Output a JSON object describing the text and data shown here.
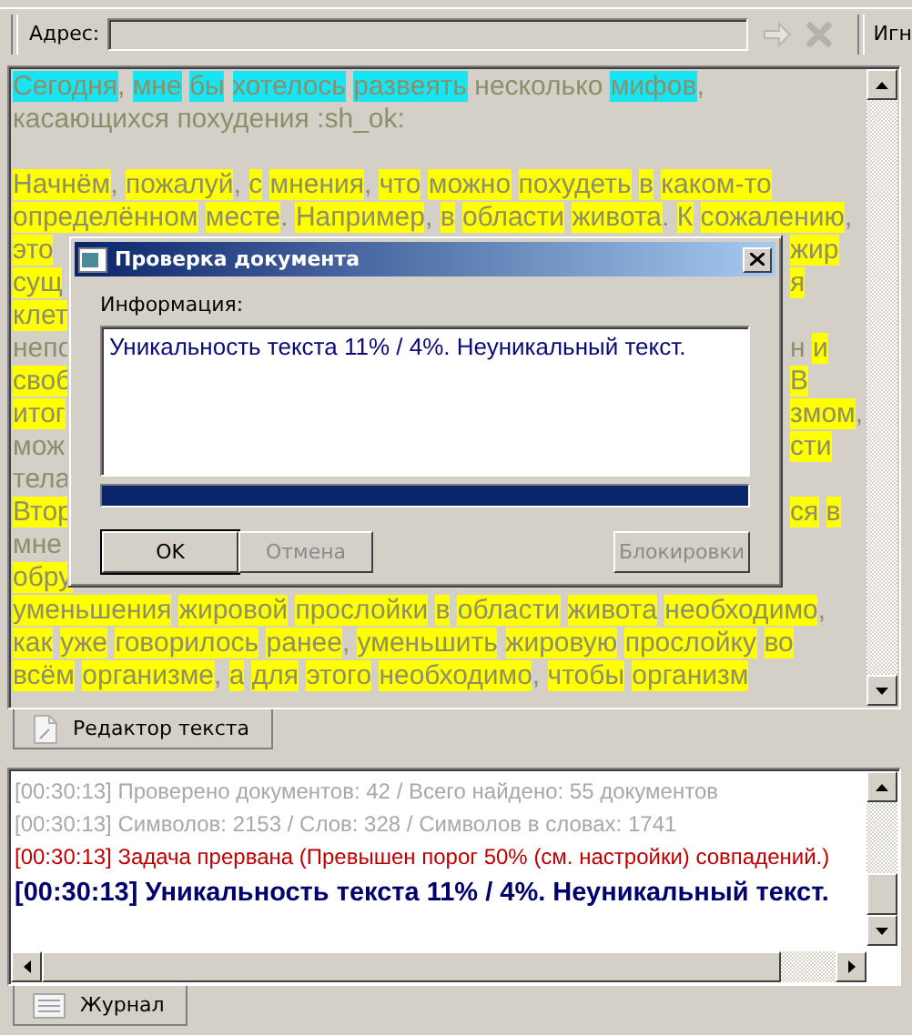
{
  "toolbar": {
    "address_label": "Адрес:",
    "right_label": "Игн"
  },
  "editor": {
    "lines": [
      {
        "kind": "full",
        "segments": [
          {
            "text": "Сегодня, мне бы хотелось развеять",
            "color": "#19e4f2"
          },
          {
            "text": " несколько "
          },
          {
            "text": "мифов,",
            "color": "#19e4f2"
          }
        ]
      },
      {
        "kind": "full",
        "segments": [
          {
            "text": "касающихся похудения :sh_ok:"
          }
        ]
      },
      {
        "kind": "blank"
      },
      {
        "kind": "full",
        "segments": [
          {
            "text": "Начнём, пожалуй, с мнения, что можно похудеть в каком-то",
            "color": "#ffff00"
          }
        ]
      },
      {
        "kind": "full",
        "segments": [
          {
            "text": "определённом месте. Например, в области живота. К сожалению,",
            "color": "#ffff00"
          }
        ]
      },
      {
        "kind": "split",
        "left": [
          {
            "text": "это",
            "color": "#ffff00"
          }
        ],
        "right": [
          {
            "text": "жир",
            "color": "#ffff00"
          }
        ]
      },
      {
        "kind": "split",
        "left": [
          {
            "text": "сущ",
            "color": "#ffff00"
          }
        ],
        "right": [
          {
            "text": "я",
            "color": "#ffff00"
          }
        ]
      },
      {
        "kind": "split",
        "left": [
          {
            "text": "клет",
            "color": "#ffff00"
          }
        ]
      },
      {
        "kind": "split",
        "left": [
          {
            "text": "непо"
          }
        ],
        "right": [
          {
            "text": "н "
          },
          {
            "text": "и",
            "color": "#ffff00"
          }
        ]
      },
      {
        "kind": "split",
        "left": [
          {
            "text": "своб",
            "color": "#ffff00"
          }
        ],
        "right": [
          {
            "text": "В",
            "color": "#ffff00"
          }
        ]
      },
      {
        "kind": "split",
        "left": [
          {
            "text": "итог",
            "color": "#ffff00"
          }
        ],
        "right": [
          {
            "text": "змом,",
            "color": "#ffff00"
          }
        ]
      },
      {
        "kind": "split",
        "left": [
          {
            "text": "мож"
          }
        ],
        "right": [
          {
            "text": "сти",
            "color": "#ffff00"
          }
        ]
      },
      {
        "kind": "split",
        "left": [
          {
            "text": "тела"
          }
        ]
      },
      {
        "kind": "split",
        "left": [
          {
            "text": "Втор",
            "color": "#ffff00"
          }
        ],
        "right": [
          {
            "text": "ся в",
            "color": "#ffff00"
          }
        ]
      },
      {
        "kind": "split",
        "left": [
          {
            "text": "мне"
          }
        ]
      },
      {
        "kind": "split",
        "left": [
          {
            "text": "обру",
            "color": "#ffff00"
          }
        ]
      },
      {
        "kind": "full",
        "segments": [
          {
            "text": "уменьшения жировой прослойки в области живота необходимо,",
            "color": "#ffff00"
          }
        ]
      },
      {
        "kind": "full",
        "segments": [
          {
            "text": "как уже говорилось ранее, уменьшить жировую прослойку во",
            "color": "#ffff00"
          }
        ]
      },
      {
        "kind": "full",
        "segments": [
          {
            "text": "всём организме, а для этого необходимо, чтобы организм",
            "color": "#ffff00"
          }
        ]
      }
    ]
  },
  "editor_tab": {
    "label": "Редактор текста",
    "selected": true
  },
  "dialog": {
    "title": "Проверка документа",
    "info_label": "Информация:",
    "info_text": "Уникальность текста 11% / 4%. Неуникальный текст.",
    "progress": {
      "level": 1
    },
    "buttons": [
      {
        "label": "OK",
        "default": true,
        "disabled": false
      },
      {
        "label": "Отмена",
        "default": false,
        "disabled": true
      },
      {
        "label": "Блокировки",
        "default": false,
        "disabled": true
      }
    ]
  },
  "log": {
    "entries": [
      {
        "text": "[00:30:13] Проверено документов: 42  / Всего найдено: 55 документов",
        "kind": "info"
      },
      {
        "text": "[00:30:13] Символов: 2153 / Слов: 328 / Символов в словах: 1741",
        "kind": "info"
      },
      {
        "text": "[00:30:13] Задача прервана (Превышен порог 50% (см. настройки) совпадений.)",
        "kind": "error"
      },
      {
        "text": "[00:30:13] Уникальность текста 11% / 4%. Неуникальный текст.",
        "kind": "result"
      }
    ]
  },
  "log_tab": {
    "label": "Журнал",
    "selected": true
  }
}
